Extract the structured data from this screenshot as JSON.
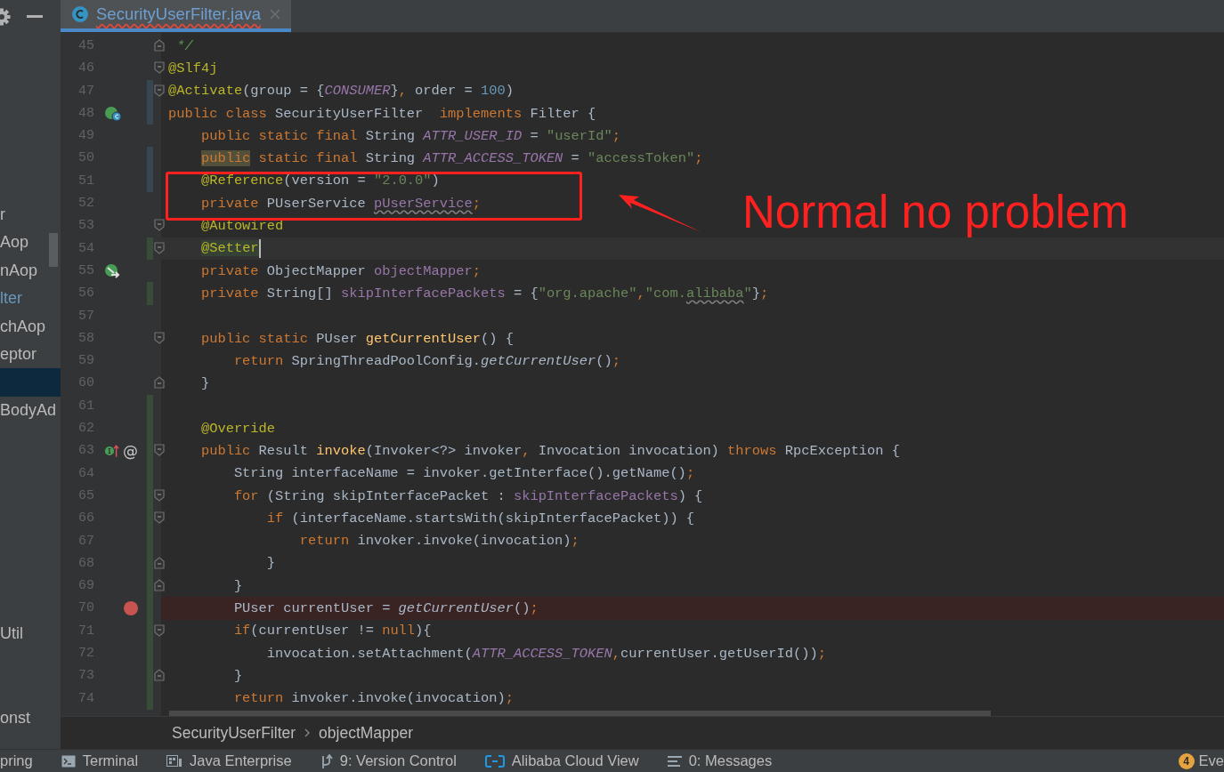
{
  "sidebar": {
    "items": [
      {
        "label": "r",
        "selected": false,
        "modified": false
      },
      {
        "label": "Aop",
        "selected": false,
        "modified": false
      },
      {
        "label": "nAop",
        "selected": false,
        "modified": false
      },
      {
        "label": "lter",
        "selected": false,
        "modified": true
      },
      {
        "label": "chAop",
        "selected": false,
        "modified": false
      },
      {
        "label": "eptor",
        "selected": false,
        "modified": false
      },
      {
        "selected": true,
        "modified": false
      },
      {
        "label": "BodyAd",
        "selected": false,
        "modified": false
      },
      {
        "label": "Util",
        "selected": false,
        "modified": false
      },
      {
        "label": "onst",
        "selected": false,
        "modified": false
      }
    ]
  },
  "tabs": [
    {
      "title": "SecurityUserFilter.java",
      "selected": true,
      "has_error": true
    }
  ],
  "editor": {
    "lines": [
      {
        "number": "45",
        "fold_start": false,
        "fold_end": true,
        "changed": false,
        "added": false,
        "current": false,
        "breakpoint": false,
        "tokens": [
          {
            "kind": "doc",
            "text": " */"
          }
        ]
      },
      {
        "number": "46",
        "fold_start": true,
        "fold_end": false,
        "changed": false,
        "added": false,
        "current": false,
        "breakpoint": false,
        "tokens": [
          {
            "kind": "ann",
            "text": "@Slf4j"
          }
        ]
      },
      {
        "number": "47",
        "fold_start": true,
        "fold_end": false,
        "changed": true,
        "added": false,
        "current": false,
        "breakpoint": false,
        "tokens": [
          {
            "kind": "ann",
            "text": "@Activate"
          },
          {
            "kind": "txt",
            "text": "(group = {"
          },
          {
            "kind": "sfield",
            "text": "CONSUMER"
          },
          {
            "kind": "txt",
            "text": "}"
          },
          {
            "kind": "punct",
            "text": ","
          },
          {
            "kind": "txt",
            "text": " order = "
          },
          {
            "kind": "num",
            "text": "100"
          },
          {
            "kind": "txt",
            "text": ")"
          }
        ]
      },
      {
        "number": "48",
        "fold_start": false,
        "fold_end": false,
        "changed": true,
        "added": false,
        "current": false,
        "breakpoint": false,
        "icons": [
          {
            "kind": "subclass"
          }
        ],
        "tokens": [
          {
            "kind": "kw",
            "text": "public class "
          },
          {
            "kind": "txt",
            "text": "SecurityUserFilter  "
          },
          {
            "kind": "kw",
            "text": "implements "
          },
          {
            "kind": "txt",
            "text": "Filter {"
          }
        ]
      },
      {
        "number": "49",
        "fold_start": false,
        "fold_end": false,
        "changed": false,
        "added": false,
        "current": false,
        "breakpoint": false,
        "tokens": [
          {
            "kind": "kw",
            "text": "    public static final "
          },
          {
            "kind": "txt",
            "text": "String "
          },
          {
            "kind": "sfield",
            "text": "ATTR_USER_ID"
          },
          {
            "kind": "txt",
            "text": " = "
          },
          {
            "kind": "str",
            "text": "\"userId\""
          },
          {
            "kind": "punct",
            "text": ";"
          }
        ]
      },
      {
        "number": "50",
        "fold_start": false,
        "fold_end": false,
        "changed": true,
        "added": false,
        "current": false,
        "breakpoint": false,
        "tokens": [
          {
            "kind": "kw",
            "text": "    public",
            "highlight": true
          },
          {
            "kind": "kw",
            "text": " static final "
          },
          {
            "kind": "txt",
            "text": "String "
          },
          {
            "kind": "sfield",
            "text": "ATTR_ACCESS_TOKEN"
          },
          {
            "kind": "txt",
            "text": " = "
          },
          {
            "kind": "str",
            "text": "\"accessToken\""
          },
          {
            "kind": "punct",
            "text": ";"
          }
        ]
      },
      {
        "number": "51",
        "fold_start": false,
        "fold_end": false,
        "changed": true,
        "added": false,
        "current": false,
        "breakpoint": false,
        "tokens": [
          {
            "kind": "ann",
            "text": "    @Reference"
          },
          {
            "kind": "txt",
            "text": "(version = "
          },
          {
            "kind": "str",
            "text": "\"2.0.0\""
          },
          {
            "kind": "txt",
            "text": ")"
          }
        ]
      },
      {
        "number": "52",
        "fold_start": false,
        "fold_end": false,
        "changed": false,
        "added": false,
        "current": false,
        "breakpoint": false,
        "tokens": [
          {
            "kind": "kw",
            "text": "    private "
          },
          {
            "kind": "txt",
            "text": "PUserService "
          },
          {
            "kind": "field",
            "text": "pUserService",
            "wavy": true
          },
          {
            "kind": "punct",
            "text": ";"
          }
        ]
      },
      {
        "number": "53",
        "fold_start": true,
        "fold_end": false,
        "changed": false,
        "added": false,
        "current": false,
        "breakpoint": false,
        "tokens": [
          {
            "kind": "ann",
            "text": "    @Autowired"
          }
        ]
      },
      {
        "number": "54",
        "fold_start": true,
        "fold_end": false,
        "changed": false,
        "added": true,
        "current": true,
        "breakpoint": false,
        "tokens": [
          {
            "kind": "ann",
            "text": "    @Setter",
            "highlight": true
          }
        ]
      },
      {
        "number": "55",
        "fold_start": false,
        "fold_end": false,
        "changed": false,
        "added": false,
        "current": false,
        "breakpoint": false,
        "icons": [
          {
            "kind": "bean"
          }
        ],
        "tokens": [
          {
            "kind": "kw",
            "text": "    private "
          },
          {
            "kind": "txt",
            "text": "ObjectMapper "
          },
          {
            "kind": "field",
            "text": "objectMapper"
          },
          {
            "kind": "punct",
            "text": ";"
          }
        ]
      },
      {
        "number": "56",
        "fold_start": false,
        "fold_end": false,
        "changed": false,
        "added": true,
        "current": false,
        "breakpoint": false,
        "tokens": [
          {
            "kind": "kw",
            "text": "    private "
          },
          {
            "kind": "txt",
            "text": "String[] "
          },
          {
            "kind": "field",
            "text": "skipInterfacePackets"
          },
          {
            "kind": "txt",
            "text": " = {"
          },
          {
            "kind": "str",
            "text": "\"org.apache\""
          },
          {
            "kind": "punct",
            "text": ","
          },
          {
            "kind": "str",
            "text": "\"com."
          },
          {
            "kind": "str",
            "text": "alibaba",
            "wavy": true
          },
          {
            "kind": "str",
            "text": "\""
          },
          {
            "kind": "txt",
            "text": "}"
          },
          {
            "kind": "punct",
            "text": ";"
          }
        ]
      },
      {
        "number": "57",
        "fold_start": false,
        "fold_end": false,
        "changed": false,
        "added": false,
        "current": false,
        "breakpoint": false
      },
      {
        "number": "58",
        "fold_start": true,
        "fold_end": false,
        "changed": false,
        "added": false,
        "current": false,
        "breakpoint": false,
        "tokens": [
          {
            "kind": "kw",
            "text": "    public static "
          },
          {
            "kind": "txt",
            "text": "PUser "
          },
          {
            "kind": "mdecl",
            "text": "getCurrentUser"
          },
          {
            "kind": "txt",
            "text": "() {"
          }
        ]
      },
      {
        "number": "59",
        "fold_start": false,
        "fold_end": false,
        "changed": false,
        "added": false,
        "current": false,
        "breakpoint": false,
        "tokens": [
          {
            "kind": "kw",
            "text": "        return "
          },
          {
            "kind": "txt",
            "text": "SpringThreadPoolConfig."
          },
          {
            "kind": "scall",
            "text": "getCurrentUser"
          },
          {
            "kind": "txt",
            "text": "()"
          },
          {
            "kind": "punct",
            "text": ";"
          }
        ]
      },
      {
        "number": "60",
        "fold_start": false,
        "fold_end": true,
        "changed": false,
        "added": false,
        "current": false,
        "breakpoint": false,
        "tokens": [
          {
            "kind": "txt",
            "text": "    }"
          }
        ]
      },
      {
        "number": "61",
        "fold_start": false,
        "fold_end": false,
        "changed": false,
        "added": true,
        "current": false,
        "breakpoint": false
      },
      {
        "number": "62",
        "fold_start": false,
        "fold_end": false,
        "changed": false,
        "added": true,
        "current": false,
        "breakpoint": false,
        "tokens": [
          {
            "kind": "ann",
            "text": "    @Override"
          }
        ]
      },
      {
        "number": "63",
        "fold_start": true,
        "fold_end": false,
        "changed": false,
        "added": true,
        "current": false,
        "breakpoint": false,
        "icons": [
          {
            "kind": "implements"
          },
          {
            "kind": "glyph",
            "text": "@"
          }
        ],
        "tokens": [
          {
            "kind": "kw",
            "text": "    public "
          },
          {
            "kind": "txt",
            "text": "Result "
          },
          {
            "kind": "mdecl",
            "text": "invoke"
          },
          {
            "kind": "txt",
            "text": "(Invoker<?> invoker"
          },
          {
            "kind": "punct",
            "text": ","
          },
          {
            "kind": "txt",
            "text": " Invocation invocation) "
          },
          {
            "kind": "kw",
            "text": "throws "
          },
          {
            "kind": "txt",
            "text": "RpcException {"
          }
        ]
      },
      {
        "number": "64",
        "fold_start": false,
        "fold_end": false,
        "changed": false,
        "added": true,
        "current": false,
        "breakpoint": false,
        "tokens": [
          {
            "kind": "txt",
            "text": "        String interfaceName = invoker.getInterface().getName()"
          },
          {
            "kind": "punct",
            "text": ";"
          }
        ]
      },
      {
        "number": "65",
        "fold_start": true,
        "fold_end": false,
        "changed": false,
        "added": true,
        "current": false,
        "breakpoint": false,
        "tokens": [
          {
            "kind": "kw",
            "text": "        for "
          },
          {
            "kind": "txt",
            "text": "(String skipInterfacePacket : "
          },
          {
            "kind": "field",
            "text": "skipInterfacePackets"
          },
          {
            "kind": "txt",
            "text": ") {"
          }
        ]
      },
      {
        "number": "66",
        "fold_start": true,
        "fold_end": false,
        "changed": false,
        "added": true,
        "current": false,
        "breakpoint": false,
        "tokens": [
          {
            "kind": "kw",
            "text": "            if "
          },
          {
            "kind": "txt",
            "text": "(interfaceName.startsWith(skipInterfacePacket)) {"
          }
        ]
      },
      {
        "number": "67",
        "fold_start": false,
        "fold_end": false,
        "changed": false,
        "added": true,
        "current": false,
        "breakpoint": false,
        "tokens": [
          {
            "kind": "kw",
            "text": "                return "
          },
          {
            "kind": "txt",
            "text": "invoker.invoke(invocation)"
          },
          {
            "kind": "punct",
            "text": ";"
          }
        ]
      },
      {
        "number": "68",
        "fold_start": false,
        "fold_end": true,
        "changed": false,
        "added": true,
        "current": false,
        "breakpoint": false,
        "tokens": [
          {
            "kind": "txt",
            "text": "            }"
          }
        ]
      },
      {
        "number": "69",
        "fold_start": false,
        "fold_end": true,
        "changed": false,
        "added": true,
        "current": false,
        "breakpoint": false,
        "tokens": [
          {
            "kind": "txt",
            "text": "        }"
          }
        ]
      },
      {
        "number": "70",
        "fold_start": false,
        "fold_end": false,
        "changed": false,
        "added": true,
        "current": false,
        "breakpoint": true,
        "tokens": [
          {
            "kind": "txt",
            "text": "        PUser currentUser = "
          },
          {
            "kind": "scall",
            "text": "getCurrentUser"
          },
          {
            "kind": "txt",
            "text": "()"
          },
          {
            "kind": "punct",
            "text": ";"
          }
        ]
      },
      {
        "number": "71",
        "fold_start": true,
        "fold_end": false,
        "changed": false,
        "added": true,
        "current": false,
        "breakpoint": false,
        "tokens": [
          {
            "kind": "kw",
            "text": "        if"
          },
          {
            "kind": "txt",
            "text": "(currentUser != "
          },
          {
            "kind": "kw",
            "text": "null"
          },
          {
            "kind": "txt",
            "text": "){"
          }
        ]
      },
      {
        "number": "72",
        "fold_start": false,
        "fold_end": false,
        "changed": false,
        "added": true,
        "current": false,
        "breakpoint": false,
        "tokens": [
          {
            "kind": "txt",
            "text": "            invocation.setAttachment("
          },
          {
            "kind": "sfield",
            "text": "ATTR_ACCESS_TOKEN"
          },
          {
            "kind": "punct",
            "text": ","
          },
          {
            "kind": "txt",
            "text": "currentUser.getUserId())"
          },
          {
            "kind": "punct",
            "text": ";"
          }
        ]
      },
      {
        "number": "73",
        "fold_start": false,
        "fold_end": true,
        "changed": false,
        "added": true,
        "current": false,
        "breakpoint": false,
        "tokens": [
          {
            "kind": "txt",
            "text": "        }"
          }
        ]
      },
      {
        "number": "74",
        "fold_start": false,
        "fold_end": false,
        "changed": false,
        "added": true,
        "current": false,
        "breakpoint": false,
        "tokens": [
          {
            "kind": "kw",
            "text": "        return "
          },
          {
            "kind": "txt",
            "text": "invoker.invoke(invocation)"
          },
          {
            "kind": "punct",
            "text": ";"
          }
        ]
      }
    ],
    "annotation": {
      "text": "Normal no problem"
    }
  },
  "breadcrumbs": [
    "SecurityUserFilter",
    "objectMapper"
  ],
  "tool_windows": [
    {
      "kind": "cut",
      "label": "pring"
    },
    {
      "kind": "terminal",
      "label": "Terminal"
    },
    {
      "kind": "enterprise",
      "label": "Java Enterprise"
    },
    {
      "kind": "vcs",
      "label": "9: Version Control"
    },
    {
      "kind": "cloud",
      "label": "Alibaba Cloud View"
    },
    {
      "kind": "messages",
      "label": "0: Messages"
    },
    {
      "kind": "event-log",
      "badge": "4",
      "label": "Eve"
    }
  ]
}
